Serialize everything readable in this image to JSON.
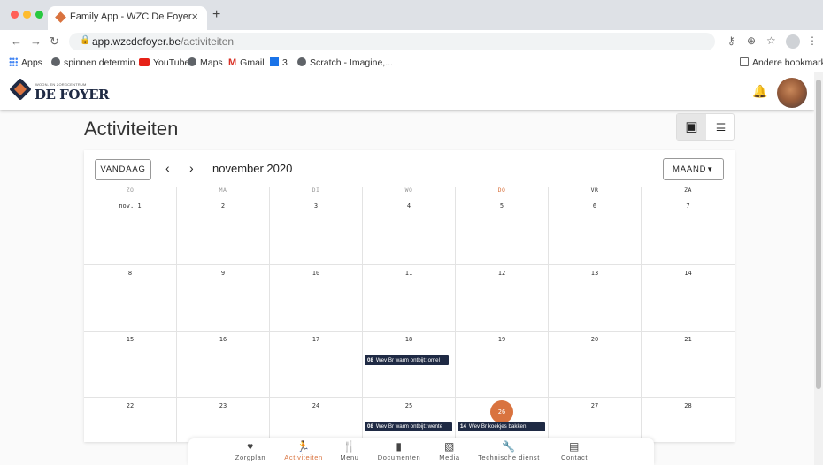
{
  "browser": {
    "tab_title": "Family App - WZC De Foyer",
    "tab_close": "×",
    "new_tab": "+",
    "url_host": "app.wzcdefoyer.be",
    "url_path": "/activiteiten",
    "bookmarks": [
      {
        "label": "Apps",
        "icon": "apps-icon"
      },
      {
        "label": "spinnen determin...",
        "icon": "globe-icon"
      },
      {
        "label": "YouTube",
        "icon": "youtube-icon"
      },
      {
        "label": "Maps",
        "icon": "globe-icon"
      },
      {
        "label": "Gmail",
        "icon": "gmail-icon"
      },
      {
        "label": "3",
        "icon": "bookmark-square-icon"
      },
      {
        "label": "Scratch - Imagine,...",
        "icon": "globe-icon"
      }
    ],
    "other_bookmarks": "Andere bookmarks"
  },
  "app": {
    "logo_small": "WOON- EN ZORGCENTRUM",
    "logo_big": "DE FOYER",
    "page_title": "Activiteiten"
  },
  "calendar": {
    "today_label": "VANDAAG",
    "prev": "‹",
    "next": "›",
    "month": "november 2020",
    "view_label": "MAAND",
    "weekdays": [
      "ZO",
      "MA",
      "DI",
      "WO",
      "DO",
      "VR",
      "ZA"
    ],
    "weeks": [
      [
        "nov. 1",
        "2",
        "3",
        "4",
        "5",
        "6",
        "7"
      ],
      [
        "8",
        "9",
        "10",
        "11",
        "12",
        "13",
        "14"
      ],
      [
        "15",
        "16",
        "17",
        "18",
        "19",
        "20",
        "21"
      ],
      [
        "22",
        "23",
        "24",
        "25",
        "26",
        "27",
        "28"
      ]
    ],
    "today": "26",
    "events": [
      {
        "time": "08",
        "title": "Wev Br warm ontbijt: omel"
      },
      {
        "time": "08",
        "title": "Wev Br warm ontbijt: wente"
      },
      {
        "time": "14",
        "title": "Wev Br koekjes bakken"
      }
    ]
  },
  "bottom_nav": [
    {
      "label": "Zorgplan",
      "icon": "heart-pulse-icon"
    },
    {
      "label": "Activiteiten",
      "icon": "person-activity-icon"
    },
    {
      "label": "Menu",
      "icon": "fork-knife-icon"
    },
    {
      "label": "Documenten",
      "icon": "document-icon"
    },
    {
      "label": "Media",
      "icon": "image-icon"
    },
    {
      "label": "Technische dienst",
      "icon": "wrench-icon"
    },
    {
      "label": "Contact",
      "icon": "message-icon"
    }
  ],
  "colors": {
    "accent": "#d9733f",
    "navy": "#1f2a44"
  }
}
